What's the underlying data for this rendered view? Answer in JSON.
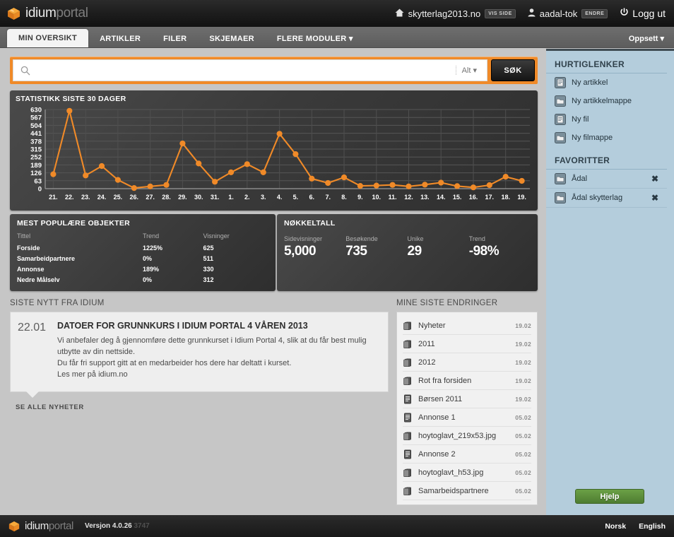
{
  "brand": {
    "name_bold": "idium",
    "name_light": "portal"
  },
  "header": {
    "site": "skytterlag2013.no",
    "site_badge": "VIS SIDE",
    "user": "aadal-tok",
    "user_badge": "ENDRE",
    "logout": "Logg ut"
  },
  "tabs": [
    {
      "label": "MIN OVERSIKT",
      "active": true
    },
    {
      "label": "ARTIKLER",
      "active": false
    },
    {
      "label": "FILER",
      "active": false
    },
    {
      "label": "SKJEMAER",
      "active": false
    },
    {
      "label": "FLERE MODULER ▾",
      "active": false
    }
  ],
  "settings_menu": "Oppsett ▾",
  "search": {
    "value": "",
    "placeholder": "",
    "scope": "Alt ▾",
    "button": "SØK"
  },
  "stats": {
    "title": "STATISTIKK SISTE 30 DAGER"
  },
  "popular": {
    "title": "MEST POPULÆRE OBJEKTER",
    "columns": [
      "Tittel",
      "Trend",
      "Visninger"
    ],
    "rows": [
      {
        "title": "Forside",
        "trend": "1225%",
        "views": "625"
      },
      {
        "title": "Samarbeidpartnere",
        "trend": "0%",
        "views": "511"
      },
      {
        "title": "Annonse",
        "trend": "189%",
        "views": "330"
      },
      {
        "title": "Nedre Målselv",
        "trend": "0%",
        "views": "312"
      }
    ]
  },
  "kpi": {
    "title": "NØKKELTALL",
    "items": [
      {
        "label": "Sidevisninger",
        "value": "5,000"
      },
      {
        "label": "Besøkende",
        "value": "735"
      },
      {
        "label": "Unike",
        "value": "29"
      },
      {
        "label": "Trend",
        "value": "-98%"
      }
    ]
  },
  "news": {
    "section_title": "SISTE NYTT FRA IDIUM",
    "date": "22.01",
    "headline": "DATOER FOR GRUNNKURS I IDIUM PORTAL 4 VÅREN 2013",
    "line1": "Vi anbefaler deg å gjennomføre dette grunnkurset i Idium Portal 4, slik at du får best mulig utbytte av din nettside.",
    "line2": "Du får fri support gitt at en medarbeider hos dere har deltatt i kurset.",
    "line3": "Les mer på idium.no",
    "see_all": "SE ALLE NYHETER"
  },
  "changes": {
    "section_title": "MINE SISTE ENDRINGER",
    "items": [
      {
        "name": "Nyheter",
        "date": "19.02",
        "icon": "folder-stack-icon"
      },
      {
        "name": "2011",
        "date": "19.02",
        "icon": "folder-stack-icon"
      },
      {
        "name": "2012",
        "date": "19.02",
        "icon": "folder-stack-icon"
      },
      {
        "name": "Rot fra forsiden",
        "date": "19.02",
        "icon": "folder-stack-icon"
      },
      {
        "name": "Børsen 2011",
        "date": "19.02",
        "icon": "document-icon"
      },
      {
        "name": "Annonse 1",
        "date": "05.02",
        "icon": "document-icon"
      },
      {
        "name": "hoytoglavt_219x53.jpg",
        "date": "05.02",
        "icon": "folder-stack-icon"
      },
      {
        "name": "Annonse 2",
        "date": "05.02",
        "icon": "document-icon"
      },
      {
        "name": "hoytoglavt_h53.jpg",
        "date": "05.02",
        "icon": "folder-stack-icon"
      },
      {
        "name": "Samarbeidspartnere",
        "date": "05.02",
        "icon": "folder-stack-icon"
      }
    ]
  },
  "sidebar": {
    "quicklinks_title": "HURTIGLENKER",
    "quicklinks": [
      {
        "label": "Ny artikkel",
        "icon": "document-icon"
      },
      {
        "label": "Ny artikkelmappe",
        "icon": "folder-icon"
      },
      {
        "label": "Ny fil",
        "icon": "document-icon"
      },
      {
        "label": "Ny filmappe",
        "icon": "folder-icon"
      }
    ],
    "favorites_title": "FAVORITTER",
    "favorites": [
      {
        "label": "Ådal",
        "icon": "folder-icon",
        "remove": "✖"
      },
      {
        "label": "Ådal skytterlag",
        "icon": "folder-icon",
        "remove": "✖"
      }
    ],
    "help_button": "Hjelp"
  },
  "footer": {
    "version": "Versjon 4.0.26",
    "build": "3747",
    "lang_no": "Norsk",
    "lang_en": "English"
  },
  "colors": {
    "accent_orange": "#f08a28",
    "sidebar_blue": "#b4cddc",
    "help_green": "#5b8f3a",
    "panel_dark": "#3a3a3a"
  },
  "chart_data": {
    "type": "line",
    "title": "STATISTIKK SISTE 30 DAGER",
    "xlabel": "",
    "ylabel": "",
    "grid": true,
    "legend": "none",
    "line_color": "#f08a28",
    "ylim": [
      0,
      630
    ],
    "yticks": [
      0,
      63,
      126,
      189,
      252,
      315,
      378,
      441,
      504,
      567,
      630
    ],
    "categories": [
      "21.",
      "22.",
      "23.",
      "24.",
      "25.",
      "26.",
      "27.",
      "28.",
      "29.",
      "30.",
      "31.",
      "1.",
      "2.",
      "3.",
      "4.",
      "5.",
      "6.",
      "7.",
      "8.",
      "9.",
      "10.",
      "11.",
      "12.",
      "13.",
      "14.",
      "15.",
      "16.",
      "17.",
      "18.",
      "19."
    ],
    "values": [
      115,
      620,
      105,
      180,
      70,
      5,
      18,
      30,
      360,
      200,
      55,
      130,
      195,
      130,
      437,
      275,
      80,
      45,
      90,
      22,
      25,
      30,
      18,
      32,
      48,
      20,
      10,
      28,
      95,
      62
    ]
  }
}
